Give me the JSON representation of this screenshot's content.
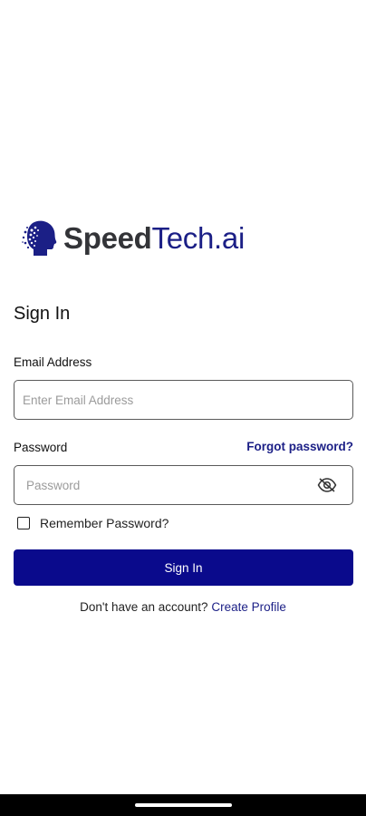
{
  "brand": {
    "name_part1": "Speed",
    "name_part2": "Tech.ai",
    "icon": "head-profile-icon",
    "primary_color": "#1b1f86",
    "dark_color": "#333438"
  },
  "form": {
    "title": "Sign In",
    "email": {
      "label": "Email Address",
      "placeholder": "Enter Email Address",
      "value": ""
    },
    "password": {
      "label": "Password",
      "placeholder": "Password",
      "value": "",
      "visibility_icon": "eye-off-icon"
    },
    "forgot_password": "Forgot password?",
    "remember_password": {
      "label": "Remember Password?",
      "checked": false
    },
    "submit_label": "Sign In",
    "submit_color": "#0a0a8c",
    "signup_prompt": "Don't have an account?",
    "signup_link": "Create Profile"
  },
  "system": {
    "nav_bar": "gesture-handle"
  }
}
